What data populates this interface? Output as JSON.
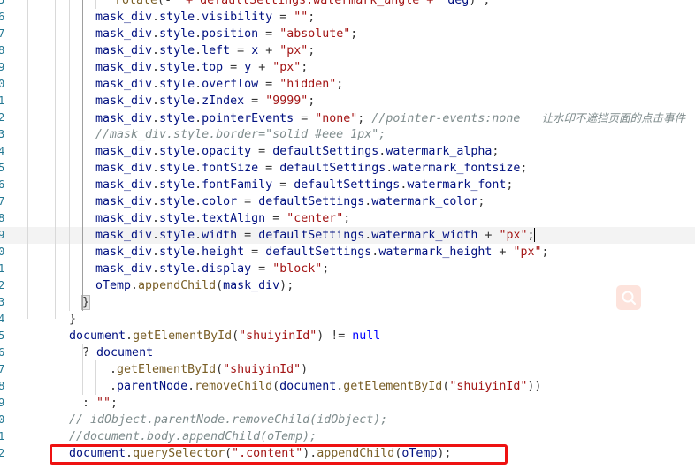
{
  "editor": {
    "line_number_digits": [
      "5",
      "6",
      "7",
      "8",
      "9",
      "0",
      "1",
      "2",
      "3",
      "4",
      "5",
      "6",
      "7",
      "8",
      "9",
      "0",
      "1",
      "2",
      "3",
      "4",
      "5",
      "6",
      "7",
      "8",
      "9",
      "0",
      "1",
      "2"
    ],
    "colors": {
      "background": "#ffffff",
      "property": "#001080",
      "string": "#a31515",
      "function": "#795e26",
      "keyword": "#0000ff",
      "comment": "#7f8c8d",
      "highlight_box": "#ee1111",
      "current_line": "#f3f3f3"
    },
    "lines": [
      "rotate(-\" + defaultSettings.watermark_angle + \"deg)\";",
      "mask_div.style.visibility = \"\";",
      "mask_div.style.position = \"absolute\";",
      "mask_div.style.left = x + \"px\";",
      "mask_div.style.top = y + \"px\";",
      "mask_div.style.overflow = \"hidden\";",
      "mask_div.style.zIndex = \"9999\";",
      "mask_div.style.pointerEvents = \"none\"; //pointer-events:none   让水印不遮挡页面的点击事件",
      "//mask_div.style.border=\"solid #eee 1px\";",
      "mask_div.style.opacity = defaultSettings.watermark_alpha;",
      "mask_div.style.fontSize = defaultSettings.watermark_fontsize;",
      "mask_div.style.fontFamily = defaultSettings.watermark_font;",
      "mask_div.style.color = defaultSettings.watermark_color;",
      "mask_div.style.textAlign = \"center\";",
      "mask_div.style.width = defaultSettings.watermark_width + \"px\";",
      "mask_div.style.height = defaultSettings.watermark_height + \"px\";",
      "mask_div.style.display = \"block\";",
      "oTemp.appendChild(mask_div);",
      "}",
      "}",
      "document.getElementById(\"shuiyinId\") != null",
      "? document",
      ".getElementById(\"shuiyinId\")",
      ".parentNode.removeChild(document.getElementById(\"shuiyinId\"))",
      ": \"\";",
      "// idObject.parentNode.removeChild(idObject);",
      "//document.body.appendChild(oTemp);",
      "document.querySelector(\".content\").appendChild(oTemp);"
    ]
  },
  "search_button_icon": "search-icon"
}
